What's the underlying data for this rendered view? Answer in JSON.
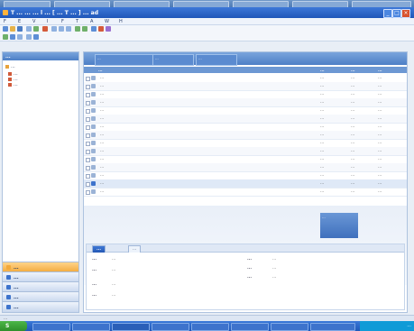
{
  "app": {
    "title": "T  ...  ...  ... l ... [ ... T ... ] ... ad",
    "window_controls": [
      "_",
      "□",
      "×"
    ]
  },
  "menu": [
    "F",
    "E",
    "V",
    "I",
    "F",
    "T",
    "A",
    "W",
    "H"
  ],
  "left_pane": {
    "header": "...",
    "tree": [
      {
        "label": "...",
        "icon_color": "#e8a33c"
      },
      {
        "label": "...",
        "icon_color": "#d05a3a"
      },
      {
        "label": "...",
        "icon_color": "#d05a3a"
      },
      {
        "label": "...",
        "icon_color": "#d05a3a"
      }
    ],
    "nav_buttons": [
      {
        "label": "...",
        "icon_color": "#f2a93b"
      },
      {
        "label": "...",
        "icon_color": "#3d73cc"
      },
      {
        "label": "...",
        "icon_color": "#3d73cc"
      },
      {
        "label": "...",
        "icon_color": "#3d73cc"
      },
      {
        "label": "...",
        "icon_color": "#3d73cc"
      }
    ]
  },
  "main": {
    "header_fields": [
      "...",
      "...",
      "..."
    ],
    "columns": [
      "...",
      "...",
      "...",
      "..."
    ],
    "rows": [
      {
        "name": "...",
        "c2": "...",
        "c3": "...",
        "c4": "..."
      },
      {
        "name": "...",
        "c2": "...",
        "c3": "...",
        "c4": "..."
      },
      {
        "name": "...",
        "c2": "...",
        "c3": "...",
        "c4": "..."
      },
      {
        "name": "...",
        "c2": "...",
        "c3": "...",
        "c4": "..."
      },
      {
        "name": "...",
        "c2": "...",
        "c3": "...",
        "c4": "..."
      },
      {
        "name": "...",
        "c2": "...",
        "c3": "...",
        "c4": "..."
      },
      {
        "name": "...",
        "c2": "...",
        "c3": "...",
        "c4": "..."
      },
      {
        "name": "...",
        "c2": "...",
        "c3": "...",
        "c4": "..."
      },
      {
        "name": "...",
        "c2": "...",
        "c3": "...",
        "c4": "..."
      },
      {
        "name": "...",
        "c2": "...",
        "c3": "...",
        "c4": "..."
      },
      {
        "name": "...",
        "c2": "...",
        "c3": "...",
        "c4": "..."
      },
      {
        "name": "...",
        "c2": "...",
        "c3": "...",
        "c4": "..."
      },
      {
        "name": "...",
        "c2": "...",
        "c3": "...",
        "c4": "..."
      },
      {
        "name": "...",
        "c2": "...",
        "c3": "...",
        "c4": "..."
      },
      {
        "name": "...",
        "c2": "...",
        "c3": "...",
        "c4": "..."
      }
    ],
    "side_panel_text": "...",
    "detail": {
      "tabs": [
        "...",
        "..."
      ],
      "fields_left": [
        {
          "label": "...",
          "value": "..."
        },
        {
          "label": "...",
          "value": "..."
        },
        {
          "label": "...",
          "value": "..."
        },
        {
          "label": "...",
          "value": "..."
        }
      ],
      "fields_right": [
        {
          "label": "...",
          "value": "..."
        },
        {
          "label": "...",
          "value": "..."
        },
        {
          "label": "...",
          "value": "..."
        }
      ]
    }
  },
  "status": {
    "text": "..."
  },
  "taskbar": {
    "start_label": "S",
    "tray_text": "..."
  },
  "colors": {
    "accent": "#4d7fc6",
    "title": "#1f56b8",
    "nav_active": "#f2a93b"
  }
}
